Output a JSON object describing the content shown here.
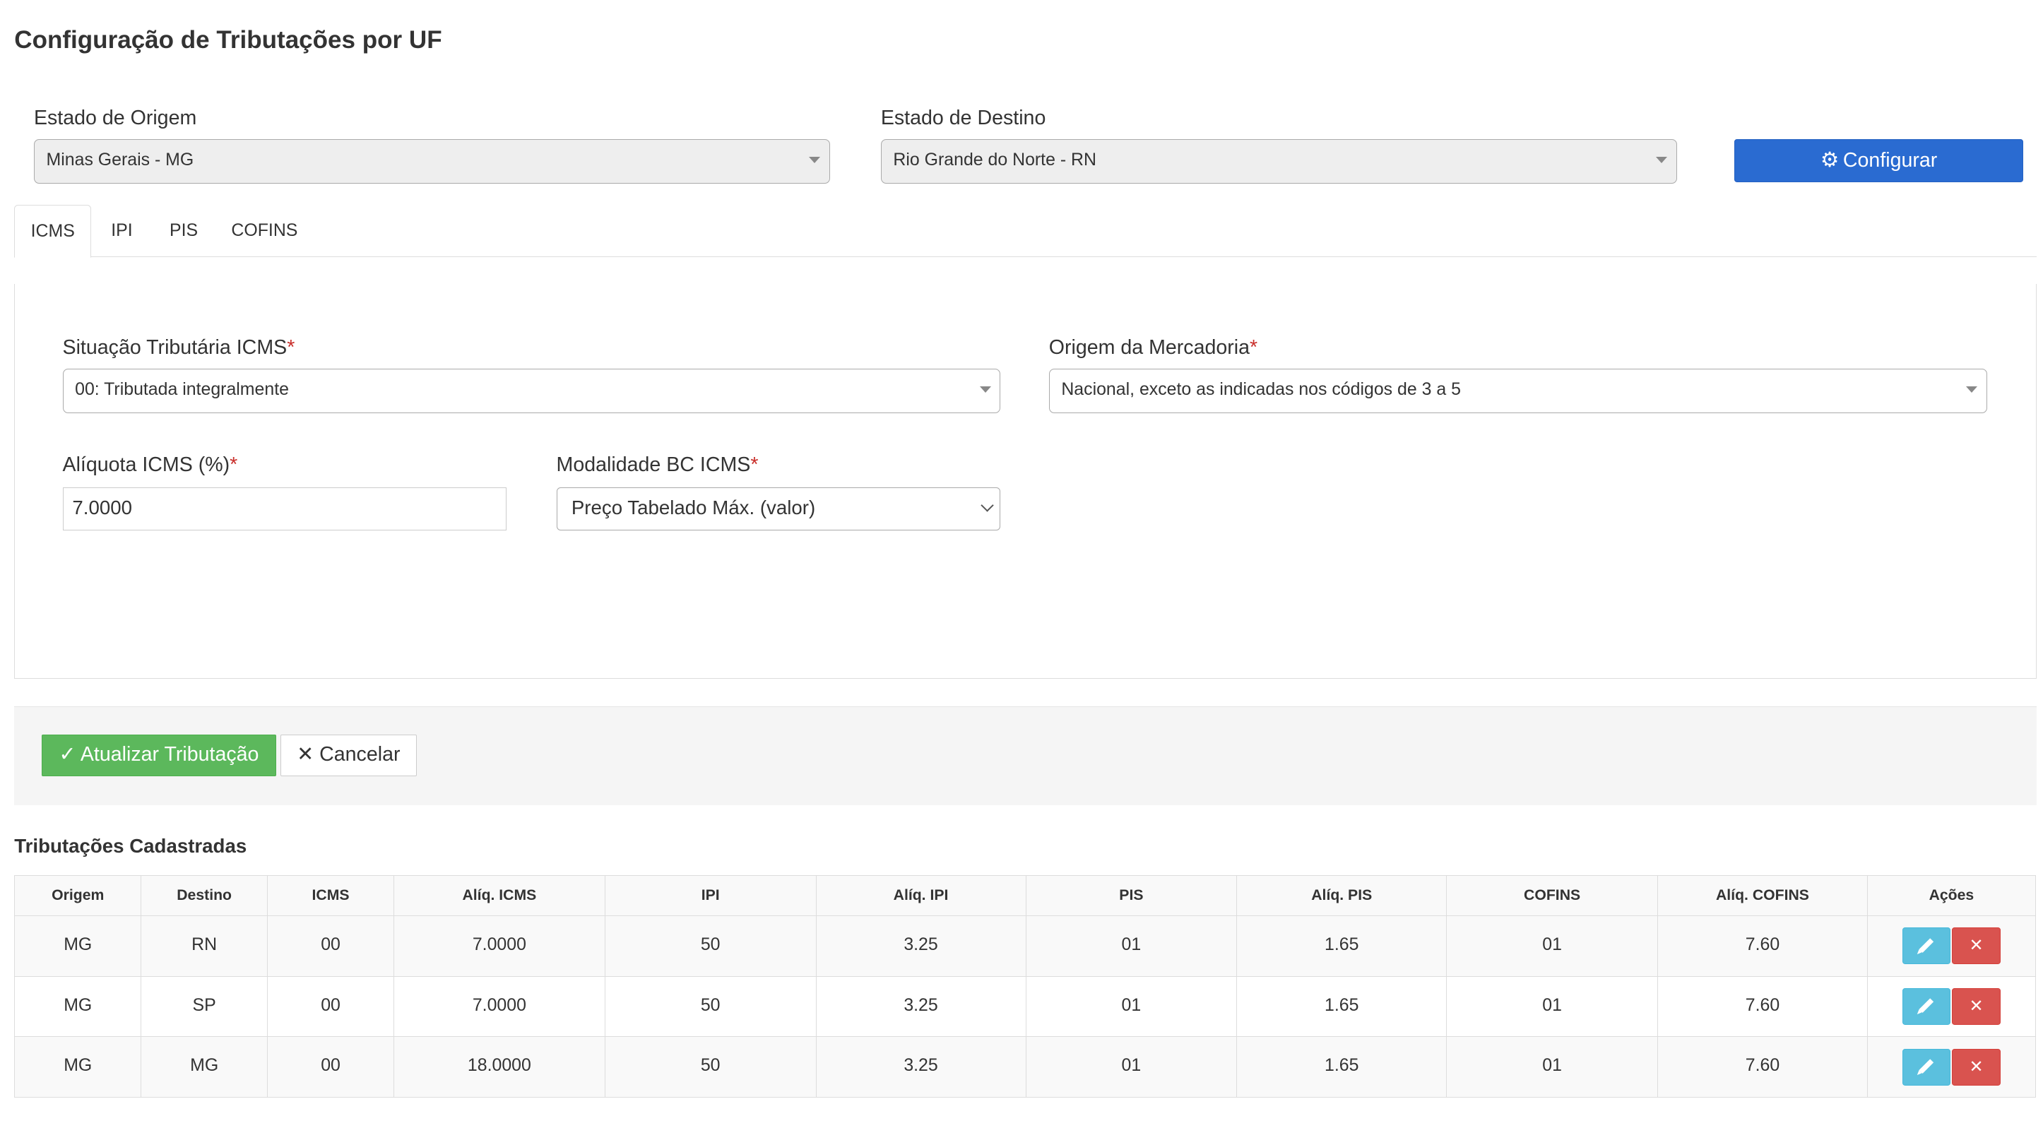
{
  "page": {
    "title": "Configuração de Tributações por UF"
  },
  "filters": {
    "origin_label": "Estado de Origem",
    "origin_value": "Minas Gerais - MG",
    "destination_label": "Estado de Destino",
    "destination_value": "Rio Grande do Norte - RN",
    "configure_label": "Configurar",
    "configure_icon": "gear-icon"
  },
  "tabs": [
    {
      "label": "ICMS",
      "active": true
    },
    {
      "label": "IPI",
      "active": false
    },
    {
      "label": "PIS",
      "active": false
    },
    {
      "label": "COFINS",
      "active": false
    }
  ],
  "icms_form": {
    "situacao_label": "Situação Tributária ICMS",
    "situacao_value": "00: Tributada integralmente",
    "origem_label": "Origem da Mercadoria",
    "origem_value": "Nacional, exceto as indicadas nos códigos de 3 a 5",
    "aliquota_label": "Alíquota ICMS (%)",
    "aliquota_value": "7.0000",
    "modalidade_label": "Modalidade BC ICMS",
    "modalidade_value": "Preço Tabelado Máx. (valor)",
    "required_mark": "*"
  },
  "actions": {
    "update_label": "Atualizar Tributação",
    "update_icon": "check-icon",
    "cancel_label": "Cancelar",
    "cancel_icon": "close-icon"
  },
  "table": {
    "title": "Tributações Cadastradas",
    "columns": [
      "Origem",
      "Destino",
      "ICMS",
      "Alíq. ICMS",
      "IPI",
      "Alíq. IPI",
      "PIS",
      "Alíq. PIS",
      "COFINS",
      "Alíq. COFINS",
      "Ações"
    ],
    "rows": [
      [
        "MG",
        "RN",
        "00",
        "7.0000",
        "50",
        "3.25",
        "01",
        "1.65",
        "01",
        "7.60"
      ],
      [
        "MG",
        "SP",
        "00",
        "7.0000",
        "50",
        "3.25",
        "01",
        "1.65",
        "01",
        "7.60"
      ],
      [
        "MG",
        "MG",
        "00",
        "18.0000",
        "50",
        "3.25",
        "01",
        "1.65",
        "01",
        "7.60"
      ]
    ],
    "row_actions": {
      "edit_icon": "pencil-icon",
      "delete_icon": "close-icon",
      "delete_glyph": "✕"
    }
  },
  "colors": {
    "primary": "#2a6bd1",
    "success": "#5cb85c",
    "info": "#5bc0de",
    "danger": "#d9534f",
    "required": "#c9302c"
  }
}
